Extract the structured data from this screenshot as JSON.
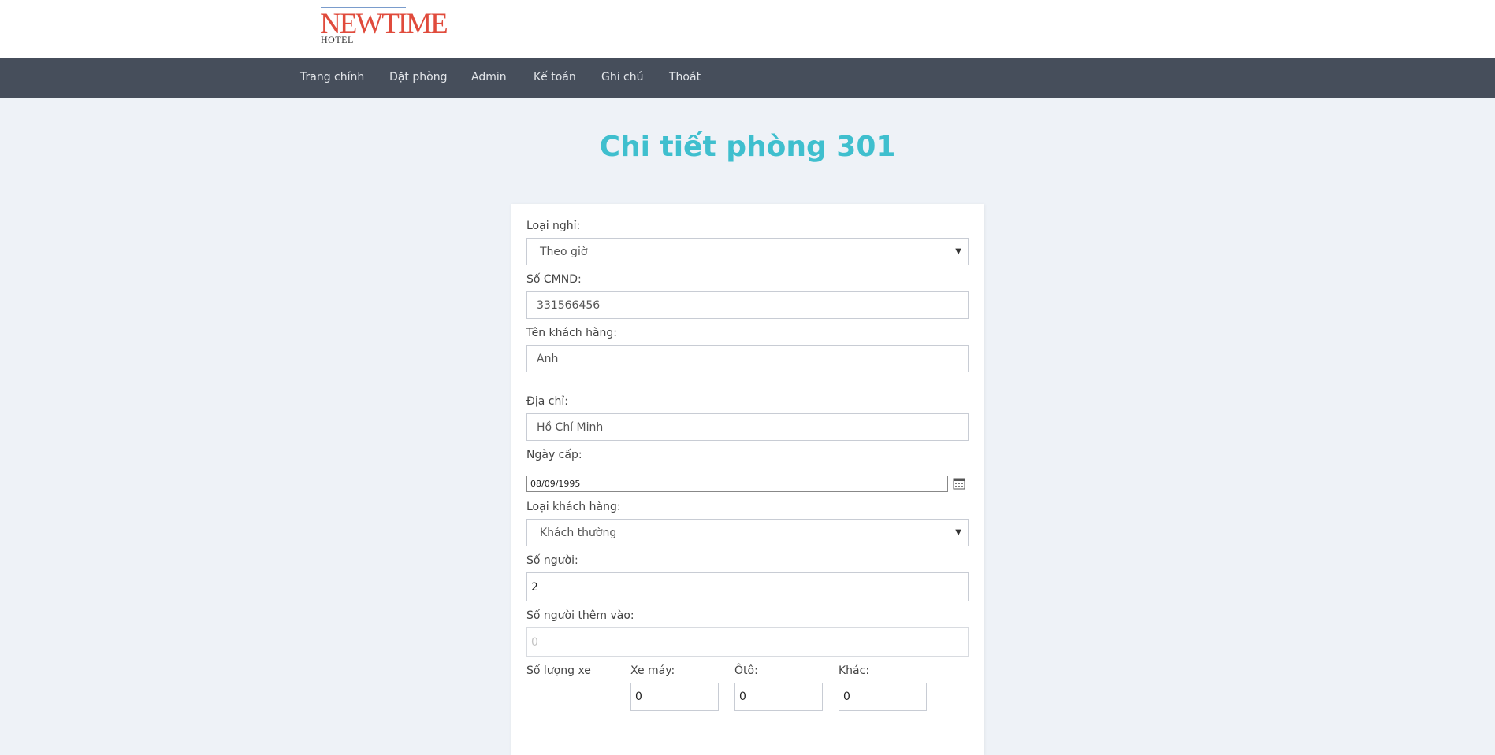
{
  "logo": {
    "brand": "NEWTIME",
    "sub": "HOTEL"
  },
  "nav": {
    "items": [
      {
        "label": "Trang chính"
      },
      {
        "label": "Đặt phòng"
      },
      {
        "label": "Admin"
      },
      {
        "label": "Kế toán"
      },
      {
        "label": "Ghi chú"
      },
      {
        "label": "Thoát"
      }
    ]
  },
  "page": {
    "title": "Chi tiết phòng 301"
  },
  "form": {
    "stay_type": {
      "label": "Loại nghỉ:",
      "value": "Theo giờ"
    },
    "id_number": {
      "label": "Số CMND:",
      "value": "331566456"
    },
    "customer_name": {
      "label": "Tên khách hàng:",
      "value": "Anh"
    },
    "address": {
      "label": "Địa chỉ:",
      "value": "Hồ Chí Minh"
    },
    "issue_date": {
      "label": "Ngày cấp:",
      "value": "08/09/1995"
    },
    "customer_type": {
      "label": "Loại khách hàng:",
      "value": "Khách thường"
    },
    "guests": {
      "label": "Số người:",
      "value": "2"
    },
    "extra_guests": {
      "label": "Số người thêm vào:",
      "placeholder": "0"
    },
    "vehicles": {
      "label": "Số lượng xe",
      "motorbike": {
        "label": "Xe máy:",
        "value": "0"
      },
      "car": {
        "label": "Ôtô:",
        "value": "0"
      },
      "other": {
        "label": "Khác:",
        "value": "0"
      }
    }
  },
  "icons": {
    "calendar": "calendar-icon",
    "dropdown": "chevron-down-icon"
  },
  "colors": {
    "accent": "#3fbfce",
    "navbar": "#464e5b",
    "background": "#eef2f7",
    "logo": "#e04b3c"
  }
}
